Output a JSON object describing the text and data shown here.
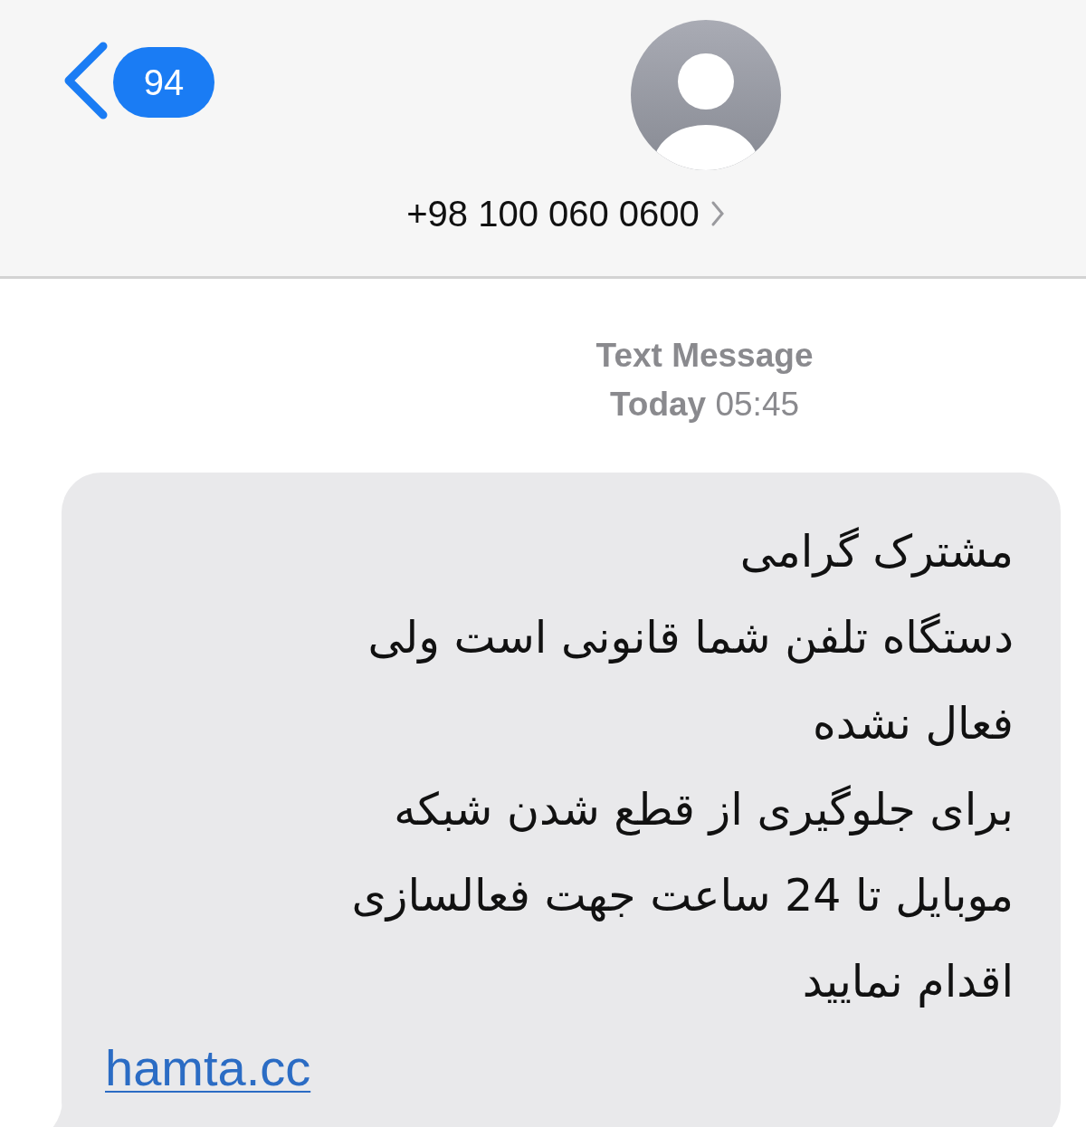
{
  "header": {
    "back_count": "94",
    "contact": "+98 100 060 0600"
  },
  "thread": {
    "service": "Text Message",
    "timestamp": "**Today** 05:45"
  },
  "messages": [
    {
      "kind": "incoming",
      "text": "مشترک گرامی\nدستگاه تلفن شما قانونی است ولی\nفعال نشده\nبرای جلوگیری از قطع شدن شبکه\nموبایل تا 24 ساعت جهت فعالسازی\nاقدام نمایید",
      "link": "hamta.cc"
    }
  ]
}
